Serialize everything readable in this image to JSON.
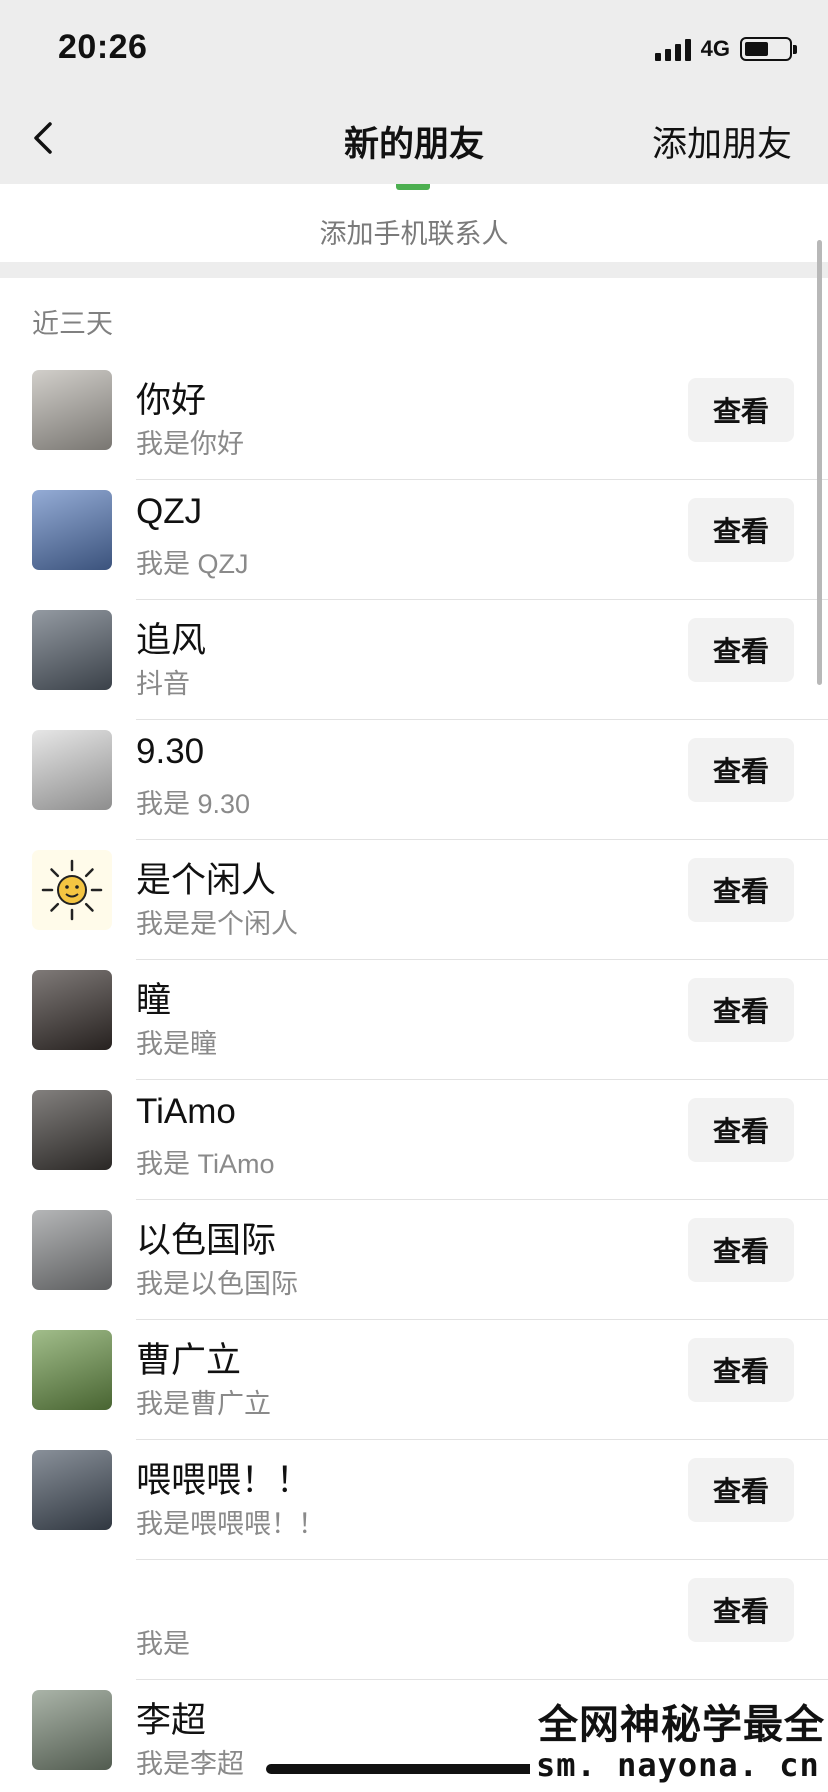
{
  "status_bar": {
    "time": "20:26",
    "network": "4G",
    "battery_level": 0.55
  },
  "nav": {
    "back_icon": "chevron-left-icon",
    "title": "新的朋友",
    "action": "添加朋友"
  },
  "add_phone": {
    "label": "添加手机联系人"
  },
  "section": {
    "title": "近三天"
  },
  "contacts": [
    {
      "name": "你好",
      "message": "我是你好",
      "button": "查看",
      "avatar_color": "#b9b5ae"
    },
    {
      "name": "QZJ",
      "message": "我是 QZJ",
      "button": "查看",
      "avatar_color": "#5b7fbf"
    },
    {
      "name": "追风",
      "message": "抖音",
      "button": "查看",
      "avatar_color": "#5a6470"
    },
    {
      "name": "9.30",
      "message": "我是 9.30",
      "button": "查看",
      "avatar_color": "#d9d9d9"
    },
    {
      "name": "是个闲人",
      "message": "我是是个闲人",
      "button": "查看",
      "avatar_color": "#fffbea"
    },
    {
      "name": "瞳",
      "message": "我是瞳",
      "button": "查看",
      "avatar_color": "#3b3330"
    },
    {
      "name": "TiAmo",
      "message": "我是 TiAmo",
      "button": "查看",
      "avatar_color": "#403c39"
    },
    {
      "name": "以色国际",
      "message": "我是以色国际",
      "button": "查看",
      "avatar_color": "#8d8f91"
    },
    {
      "name": "曹广立",
      "message": "我是曹广立",
      "button": "查看",
      "avatar_color": "#6f9a4c"
    },
    {
      "name": "喂喂喂！！",
      "message": "我是喂喂喂！！",
      "button": "查看",
      "avatar_color": "#4a5563"
    },
    {
      "name": "",
      "message": "我是",
      "button": "查看",
      "avatar_color": ""
    },
    {
      "name": "李超",
      "message": "我是李超",
      "button": "查看",
      "avatar_color": "#7d8c7a"
    }
  ],
  "watermark": {
    "line1": "全网神秘学最全",
    "line2": "sm. nayona. cn"
  }
}
